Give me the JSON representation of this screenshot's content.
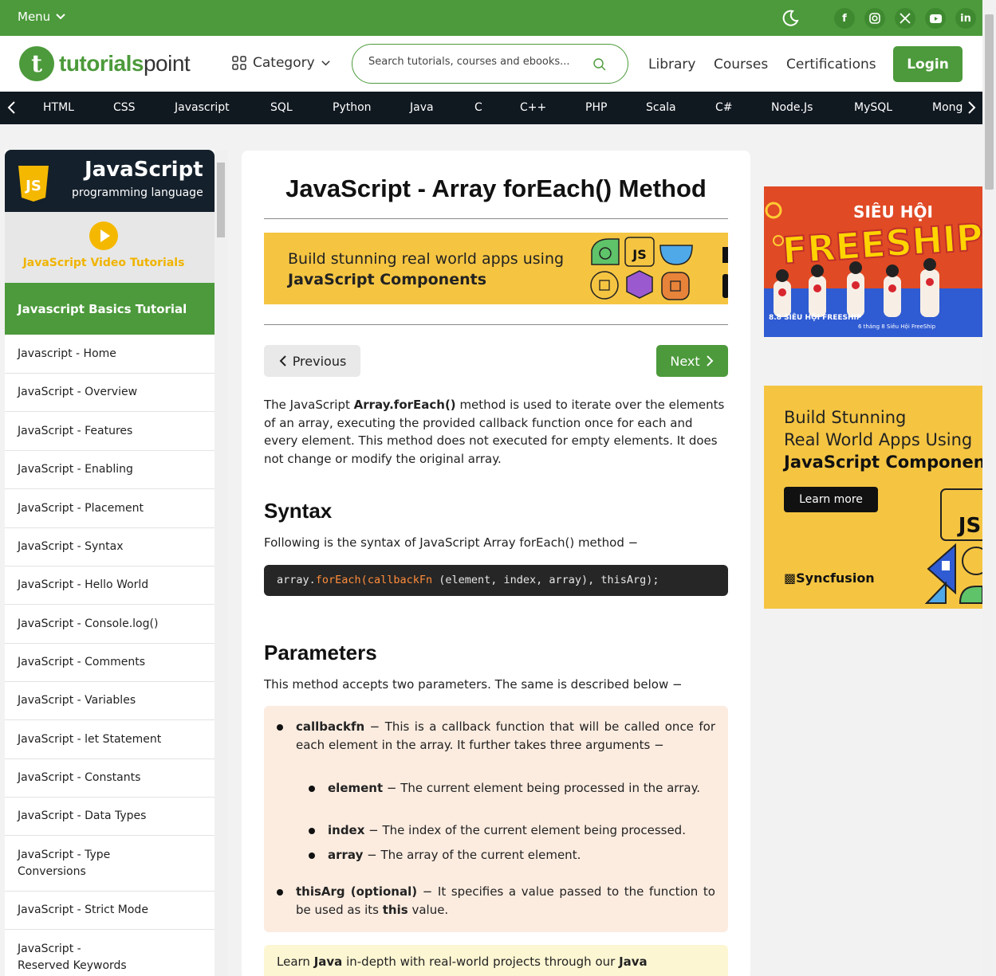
{
  "topbar": {
    "menu_label": "Menu",
    "social": [
      "facebook-icon",
      "instagram-icon",
      "x-icon",
      "youtube-icon",
      "linkedin-icon"
    ]
  },
  "header": {
    "logo": {
      "part1": "tutorials",
      "part2": "point"
    },
    "category_label": "Category",
    "search_placeholder": "Search tutorials, courses and ebooks...",
    "nav": [
      "Library",
      "Courses",
      "Certifications"
    ],
    "login_label": "Login"
  },
  "languages": [
    "HTML",
    "CSS",
    "Javascript",
    "SQL",
    "Python",
    "Java",
    "C",
    "C++",
    "PHP",
    "Scala",
    "C#",
    "Node.Js",
    "MySQL",
    "Mong"
  ],
  "sidebar": {
    "title": "JavaScript",
    "subtitle": "programming language",
    "badge": "JS",
    "video_label": "JavaScript Video Tutorials",
    "section_heading": "Javascript Basics Tutorial",
    "items": [
      "Javascript - Home",
      "JavaScript - Overview",
      "JavaScript - Features",
      "JavaScript - Enabling",
      "JavaScript - Placement",
      "JavaScript - Syntax",
      "JavaScript - Hello World",
      "JavaScript - Console.log()",
      "JavaScript - Comments",
      "JavaScript - Variables",
      "JavaScript - let Statement",
      "JavaScript - Constants",
      "JavaScript - Data Types",
      "JavaScript - Type Conversions",
      "JavaScript - Strict Mode",
      "JavaScript - Reserved Keywords"
    ]
  },
  "article": {
    "title": "JavaScript - Array forEach() Method",
    "banner": {
      "line1": "Build stunning real world apps using",
      "line2": "JavaScript Components"
    },
    "prev_label": "Previous",
    "next_label": "Next",
    "intro": {
      "pre": "The JavaScript ",
      "bold": "Array.forEach()",
      "post": " method is used to iterate over the elements of an array, executing the provided callback function once for each and every element. This method does not executed for empty elements. It does not change or modify the original array."
    },
    "syntax_heading": "Syntax",
    "syntax_text": "Following is the syntax of JavaScript Array forEach() method −",
    "code": {
      "obj": "array.",
      "method": "forEach(",
      "arg": "callbackFn",
      "rest": " (element, index, array), thisArg);"
    },
    "params_heading": "Parameters",
    "params_text": "This method accepts two parameters. The same is described below −",
    "params": [
      {
        "name": "callbackfn",
        "desc": " − This is a callback function that will be called once for each element in the array. It further takes three arguments −"
      },
      {
        "name": "thisArg (optional)",
        "desc": " − It specifies a value passed to the function to be used as its ",
        "bold_end": "this",
        "end": " value."
      }
    ],
    "subparams": [
      {
        "name": "element",
        "desc": " − The current element being processed in the array."
      },
      {
        "name": "index",
        "desc": " − The index of the current element being processed."
      },
      {
        "name": "array",
        "desc": " − The array of the current element."
      }
    ],
    "tip": {
      "pre": "Learn ",
      "b1": "Java",
      "mid": " in-depth with real-world projects through our ",
      "b2": "Java"
    }
  },
  "ads": {
    "ad1": {
      "title": "SIÊU HỘI",
      "headline": "FREESHIP",
      "caption": "8.8 SIÊU HỘI FREESHIP",
      "subcaption": "6 tháng 8 Siêu Hội FreeShip"
    },
    "ad2": {
      "line1": "Build Stunning",
      "line2": "Real World Apps Using",
      "line3": "JavaScript Components",
      "cta": "Learn more",
      "brand": "Syncfusion",
      "badge": "JS"
    }
  },
  "colors": {
    "brand_green": "#4c9a3b",
    "dark_nav": "#101820",
    "banner_yellow": "#f5c542",
    "params_bg": "#fcece0"
  }
}
